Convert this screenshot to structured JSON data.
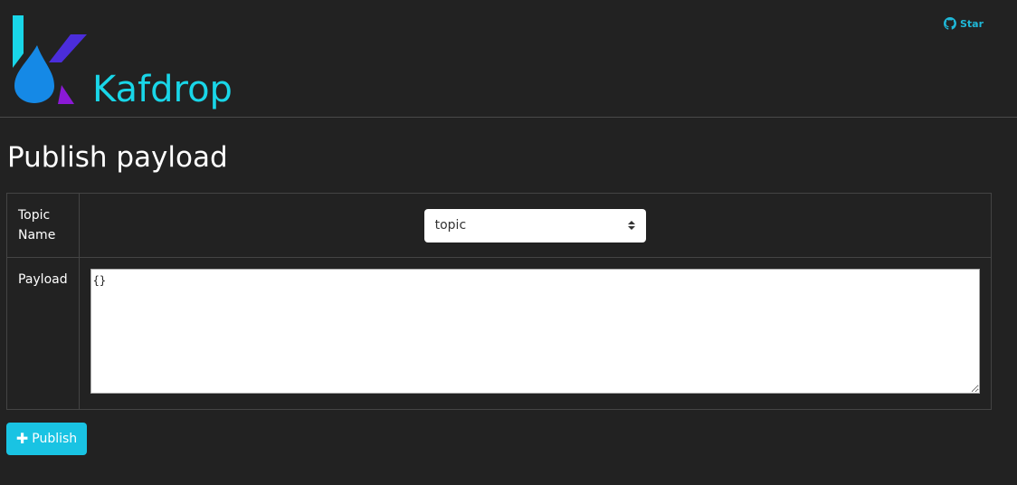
{
  "header": {
    "brand_name": "Kafdrop",
    "github_star_label": "Star",
    "accent_color": "#19d6e8"
  },
  "page": {
    "title": "Publish payload"
  },
  "form": {
    "topic_label": "Topic Name",
    "topic_selected": "topic",
    "payload_label": "Payload",
    "payload_value": "{}"
  },
  "actions": {
    "publish_icon": "plus-icon",
    "publish_label": "Publish",
    "publish_color": "#19c3e3"
  }
}
